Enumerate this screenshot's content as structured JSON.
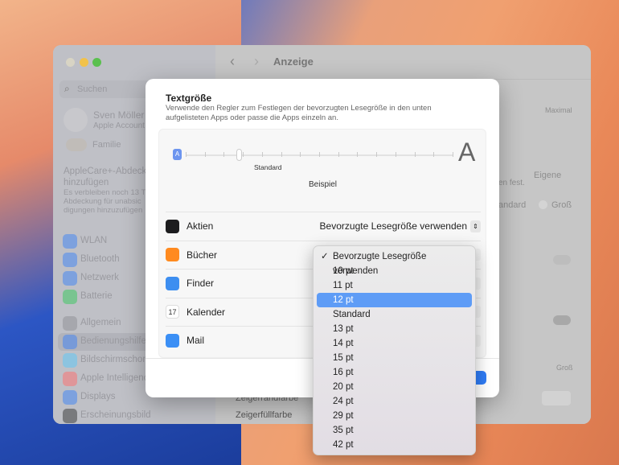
{
  "window": {
    "title": "Anzeige"
  },
  "sidebar": {
    "search_placeholder": "Suchen",
    "user_name": "Sven Möller",
    "user_sub": "Apple Account",
    "family": "Familie",
    "applecare_title_1": "AppleCare+-Abdeck",
    "applecare_title_2": "hinzufügen",
    "applecare_text_1": "Es verbleiben noch 13 T",
    "applecare_text_2": "Abdeckung für unabsic",
    "applecare_text_3": "digungen hinzuzufügen",
    "items": [
      {
        "label": "WLAN",
        "color": "#3b82f6"
      },
      {
        "label": "Bluetooth",
        "color": "#3b82f6"
      },
      {
        "label": "Netzwerk",
        "color": "#3b82f6"
      },
      {
        "label": "Batterie",
        "color": "#34c759"
      },
      {
        "label": "Allgemein",
        "color": "#8e8e93"
      },
      {
        "label": "Bedienungshilfen",
        "color": "#3b82f6"
      },
      {
        "label": "Bildschirmschoner",
        "color": "#5ac8fa"
      },
      {
        "label": "Apple Intelligence",
        "color": "#ff6b6b"
      },
      {
        "label": "Displays",
        "color": "#3b82f6"
      },
      {
        "label": "Erscheinungsbild",
        "color": "#333333"
      }
    ]
  },
  "main_bg": {
    "maximal": "Maximal",
    "fest": "en fest.",
    "eigene": "Eigene",
    "standard": "andard",
    "gross": "Groß",
    "gross2": "Groß",
    "zeigerrand": "Zeigerrandfarbe",
    "zeigerfuell": "Zeigerfüllfarbe"
  },
  "sheet": {
    "title": "Textgröße",
    "description": "Verwende den Regler zum Festlegen der bevorzugten Lesegröße in den unten aufgelisteten Apps oder passe die Apps einzeln an.",
    "slider_label": "Standard",
    "slider_value_fraction": 0.2,
    "sample": "Beispiel",
    "big_a": "A",
    "small_a": "A",
    "apps": [
      {
        "name": "Aktien",
        "value": "Bevorzugte Lesegröße verwenden",
        "color": "#1c1c1e"
      },
      {
        "name": "Bücher",
        "color": "#ff8a1f"
      },
      {
        "name": "Finder",
        "color": "#3d8ef0"
      },
      {
        "name": "Kalender",
        "color": "#ffffff",
        "icon_text": "17"
      },
      {
        "name": "Mail",
        "color": "#3b8ff5"
      }
    ]
  },
  "menu": {
    "selected_check": "✓",
    "items": [
      "Bevorzugte Lesegröße verwenden",
      "10 pt",
      "11 pt",
      "12 pt",
      "Standard",
      "13 pt",
      "14 pt",
      "15 pt",
      "16 pt",
      "20 pt",
      "24 pt",
      "29 pt",
      "35 pt",
      "42 pt"
    ],
    "checked_index": 0,
    "highlighted_index": 3
  }
}
